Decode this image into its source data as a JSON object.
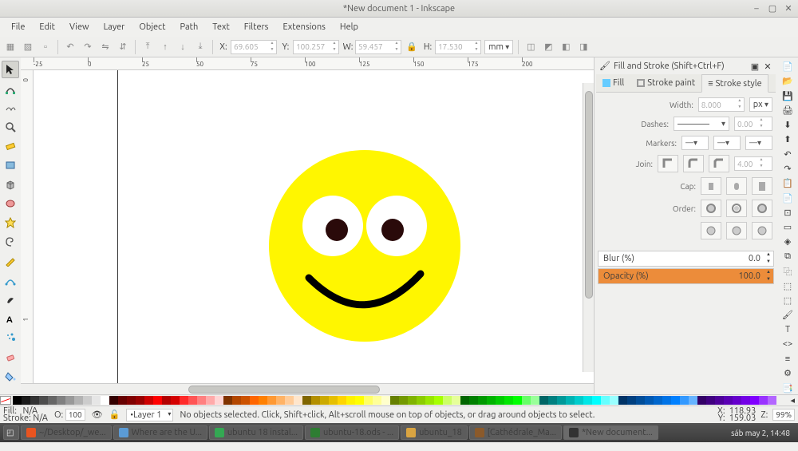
{
  "window": {
    "title": "*New document 1 - Inkscape"
  },
  "menu": {
    "file": "File",
    "edit": "Edit",
    "view": "View",
    "layer": "Layer",
    "object": "Object",
    "path": "Path",
    "text": "Text",
    "filters": "Filters",
    "extensions": "Extensions",
    "help": "Help"
  },
  "propbar": {
    "x_label": "X:",
    "x": "69.605",
    "y_label": "Y:",
    "y": "100.257",
    "w_label": "W:",
    "w": "59.457",
    "h_label": "H:",
    "h": "17.530",
    "unit": "mm"
  },
  "ruler_h": [
    "-25",
    "0",
    "25",
    "50",
    "75",
    "100",
    "125",
    "150",
    "175",
    "200"
  ],
  "ruler_v": [
    "0",
    "1"
  ],
  "dialog": {
    "title": "Fill and Stroke (Shift+Ctrl+F)",
    "tabs": {
      "fill": "Fill",
      "paint": "Stroke paint",
      "style": "Stroke style"
    },
    "width_label": "Width:",
    "width_val": "8.000",
    "width_unit": "px",
    "dashes_label": "Dashes:",
    "dashes_offset": "0.00",
    "markers_label": "Markers:",
    "join_label": "Join:",
    "join_val": "4.00",
    "cap_label": "Cap:",
    "order_label": "Order:",
    "blur_label": "Blur (%)",
    "blur_val": "0.0",
    "opacity_label": "Opacity (%)",
    "opacity_val": "100.0"
  },
  "palette_colors": [
    "#000000",
    "#1a1a1a",
    "#333333",
    "#4d4d4d",
    "#666666",
    "#808080",
    "#999999",
    "#b3b3b3",
    "#cccccc",
    "#e6e6e6",
    "#ffffff",
    "#330000",
    "#660000",
    "#800000",
    "#990000",
    "#cc0000",
    "#ff0000",
    "#b30000",
    "#d40000",
    "#ff2a2a",
    "#ff5555",
    "#ff8080",
    "#ffaaaa",
    "#ffd5d5",
    "#803300",
    "#b34700",
    "#cc5200",
    "#ff6600",
    "#ff8000",
    "#ff9933",
    "#ffb366",
    "#ffcc99",
    "#ffe6cc",
    "#806600",
    "#b38f00",
    "#ccaa00",
    "#e6bf00",
    "#ffd500",
    "#fff200",
    "#ffff00",
    "#ffff66",
    "#ffff99",
    "#ffffcc",
    "#668000",
    "#739900",
    "#80b300",
    "#8ccc00",
    "#99e600",
    "#a6ff00",
    "#ccff66",
    "#e6ff99",
    "#006600",
    "#008000",
    "#009900",
    "#00b300",
    "#00cc00",
    "#00e600",
    "#00ff00",
    "#66ff66",
    "#99ff99",
    "#006666",
    "#008080",
    "#009999",
    "#00b3b3",
    "#00cccc",
    "#00e6e6",
    "#00ffff",
    "#66ffff",
    "#99ffff",
    "#003366",
    "#004080",
    "#004d99",
    "#0059b3",
    "#0066cc",
    "#0073e6",
    "#0080ff",
    "#3399ff",
    "#66b3ff",
    "#330066",
    "#400080",
    "#4d0099",
    "#5900b3",
    "#6600cc",
    "#7300e6",
    "#8000ff",
    "#9933ff",
    "#b366ff"
  ],
  "status": {
    "fill_label": "Fill:",
    "stroke_label": "Stroke:",
    "na": "N/A",
    "opacity_label": "O:",
    "opacity_val": "100",
    "layer": "Layer 1",
    "hint": "No objects selected. Click, Shift+click, Alt+scroll mouse on top of objects, or drag around objects to select.",
    "x_label": "X:",
    "x": "118.93",
    "y_label": "Y:",
    "y": "159.03",
    "z_label": "Z:",
    "zoom": "99%"
  },
  "taskbar": {
    "items": [
      {
        "label": "~/Desktop/_we...",
        "color": "#e95420"
      },
      {
        "label": "Where are the U...",
        "color": "#5b9bd5"
      },
      {
        "label": "ubuntu 18 instal...",
        "color": "#34a853"
      },
      {
        "label": "ubuntu-18.ods - ...",
        "color": "#2e7d32"
      },
      {
        "label": "ubuntu_18",
        "color": "#d9a441"
      },
      {
        "label": "[Cathédrale_Ma...",
        "color": "#8b5a2b"
      },
      {
        "label": "*New document...",
        "color": "#333333"
      }
    ],
    "clock": "sáb may  2, 14:48"
  }
}
